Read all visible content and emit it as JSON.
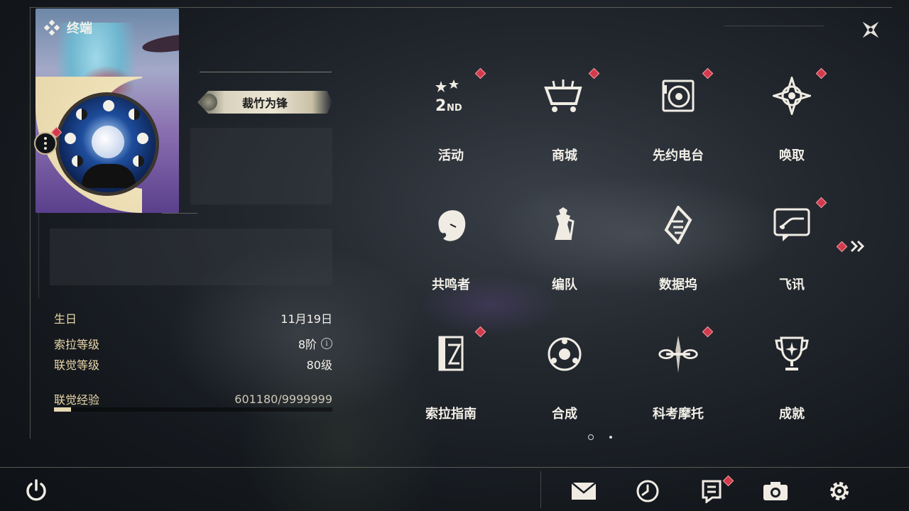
{
  "header": {
    "title": "终端"
  },
  "profile": {
    "title_badge": "裁竹为锋",
    "birthday_label": "生日",
    "birthday_value": "11月19日",
    "sola_level_label": "索拉等级",
    "sola_level_value": "8阶",
    "info_icon_glyph": "i",
    "union_level_label": "联觉等级",
    "union_level_value": "80级",
    "union_exp_label": "联觉经验",
    "union_exp_value": "601180/9999999",
    "union_exp_fraction": 0.06
  },
  "grid": {
    "items": [
      {
        "label": "活动",
        "icon": "event-2nd-icon",
        "badge": true
      },
      {
        "label": "商城",
        "icon": "shop-cart-icon",
        "badge": true
      },
      {
        "label": "先约电台",
        "icon": "radio-icon",
        "badge": true
      },
      {
        "label": "唤取",
        "icon": "convene-icon",
        "badge": true
      },
      {
        "label": "共鸣者",
        "icon": "resonator-icon",
        "badge": false
      },
      {
        "label": "编队",
        "icon": "team-chess-icon",
        "badge": false
      },
      {
        "label": "数据坞",
        "icon": "data-bank-icon",
        "badge": false
      },
      {
        "label": "飞讯",
        "icon": "message-icon",
        "badge": true
      },
      {
        "label": "索拉指南",
        "icon": "guidebook-icon",
        "badge": true
      },
      {
        "label": "合成",
        "icon": "synthesis-icon",
        "badge": false
      },
      {
        "label": "科考摩托",
        "icon": "motorbike-icon",
        "badge": true
      },
      {
        "label": "成就",
        "icon": "trophy-icon",
        "badge": false
      }
    ]
  },
  "pager": {
    "current_page": 1,
    "page_count": 2
  },
  "bottom_bar": {
    "icons": [
      "mail-icon",
      "clock-icon",
      "notice-icon",
      "camera-icon",
      "settings-icon"
    ]
  },
  "colors": {
    "accent_gold": "#e9d7a8",
    "badge_red": "#d43a4c",
    "text_light": "#f2efe7"
  }
}
